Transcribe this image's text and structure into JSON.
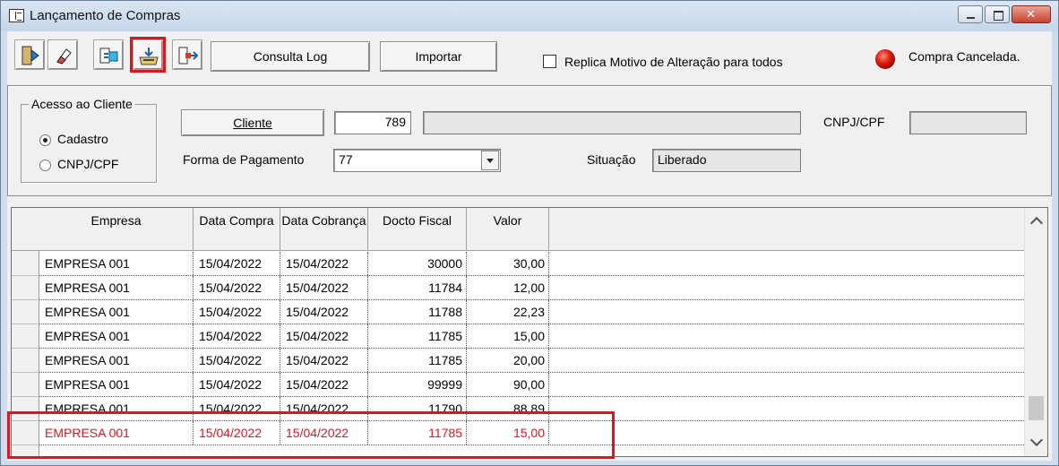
{
  "window": {
    "title": "Lançamento de Compras"
  },
  "toolbar": {
    "icons": [
      "exit-icon",
      "eraser-icon",
      "add-record-icon",
      "import-tray-icon",
      "export-icon"
    ],
    "consulta_log": "Consulta Log",
    "importar": "Importar",
    "replica_label": "Replica Motivo de Alteração para todos",
    "replica_checked": false,
    "status_text": "Compra Cancelada.",
    "status_color": "#e01b0f"
  },
  "form": {
    "group_title": "Acesso ao Cliente",
    "radio_cadastro": "Cadastro",
    "radio_cnpj": "CNPJ/CPF",
    "selected_radio": "Cadastro",
    "cliente_button": "Cliente",
    "cliente_code": "789",
    "cliente_name": "",
    "cnpj_label": "CNPJ/CPF",
    "cnpj_value": "",
    "forma_label": "Forma de Pagamento",
    "forma_value": "77",
    "situacao_label": "Situação",
    "situacao_value": "Liberado"
  },
  "grid": {
    "columns": [
      "Empresa",
      "Data Compra",
      "Data Cobrança",
      "Docto Fiscal",
      "Valor"
    ],
    "rows": [
      {
        "empresa": "EMPRESA 001",
        "data_compra": "15/04/2022",
        "data_cobranca": "15/04/2022",
        "docto": "30000",
        "valor": "30,00"
      },
      {
        "empresa": "EMPRESA 001",
        "data_compra": "15/04/2022",
        "data_cobranca": "15/04/2022",
        "docto": "11784",
        "valor": "12,00"
      },
      {
        "empresa": "EMPRESA 001",
        "data_compra": "15/04/2022",
        "data_cobranca": "15/04/2022",
        "docto": "11788",
        "valor": "22,23"
      },
      {
        "empresa": "EMPRESA 001",
        "data_compra": "15/04/2022",
        "data_cobranca": "15/04/2022",
        "docto": "11785",
        "valor": "15,00"
      },
      {
        "empresa": "EMPRESA 001",
        "data_compra": "15/04/2022",
        "data_cobranca": "15/04/2022",
        "docto": "11785",
        "valor": "20,00"
      },
      {
        "empresa": "EMPRESA 001",
        "data_compra": "15/04/2022",
        "data_cobranca": "15/04/2022",
        "docto": "99999",
        "valor": "90,00"
      },
      {
        "empresa": "EMPRESA 001",
        "data_compra": "15/04/2022",
        "data_cobranca": "15/04/2022",
        "docto": "11790",
        "valor": "88,89"
      },
      {
        "empresa": "EMPRESA 001",
        "data_compra": "15/04/2022",
        "data_cobranca": "15/04/2022",
        "docto": "11785",
        "valor": "15,00"
      }
    ],
    "highlight_color": "#e0141e"
  }
}
